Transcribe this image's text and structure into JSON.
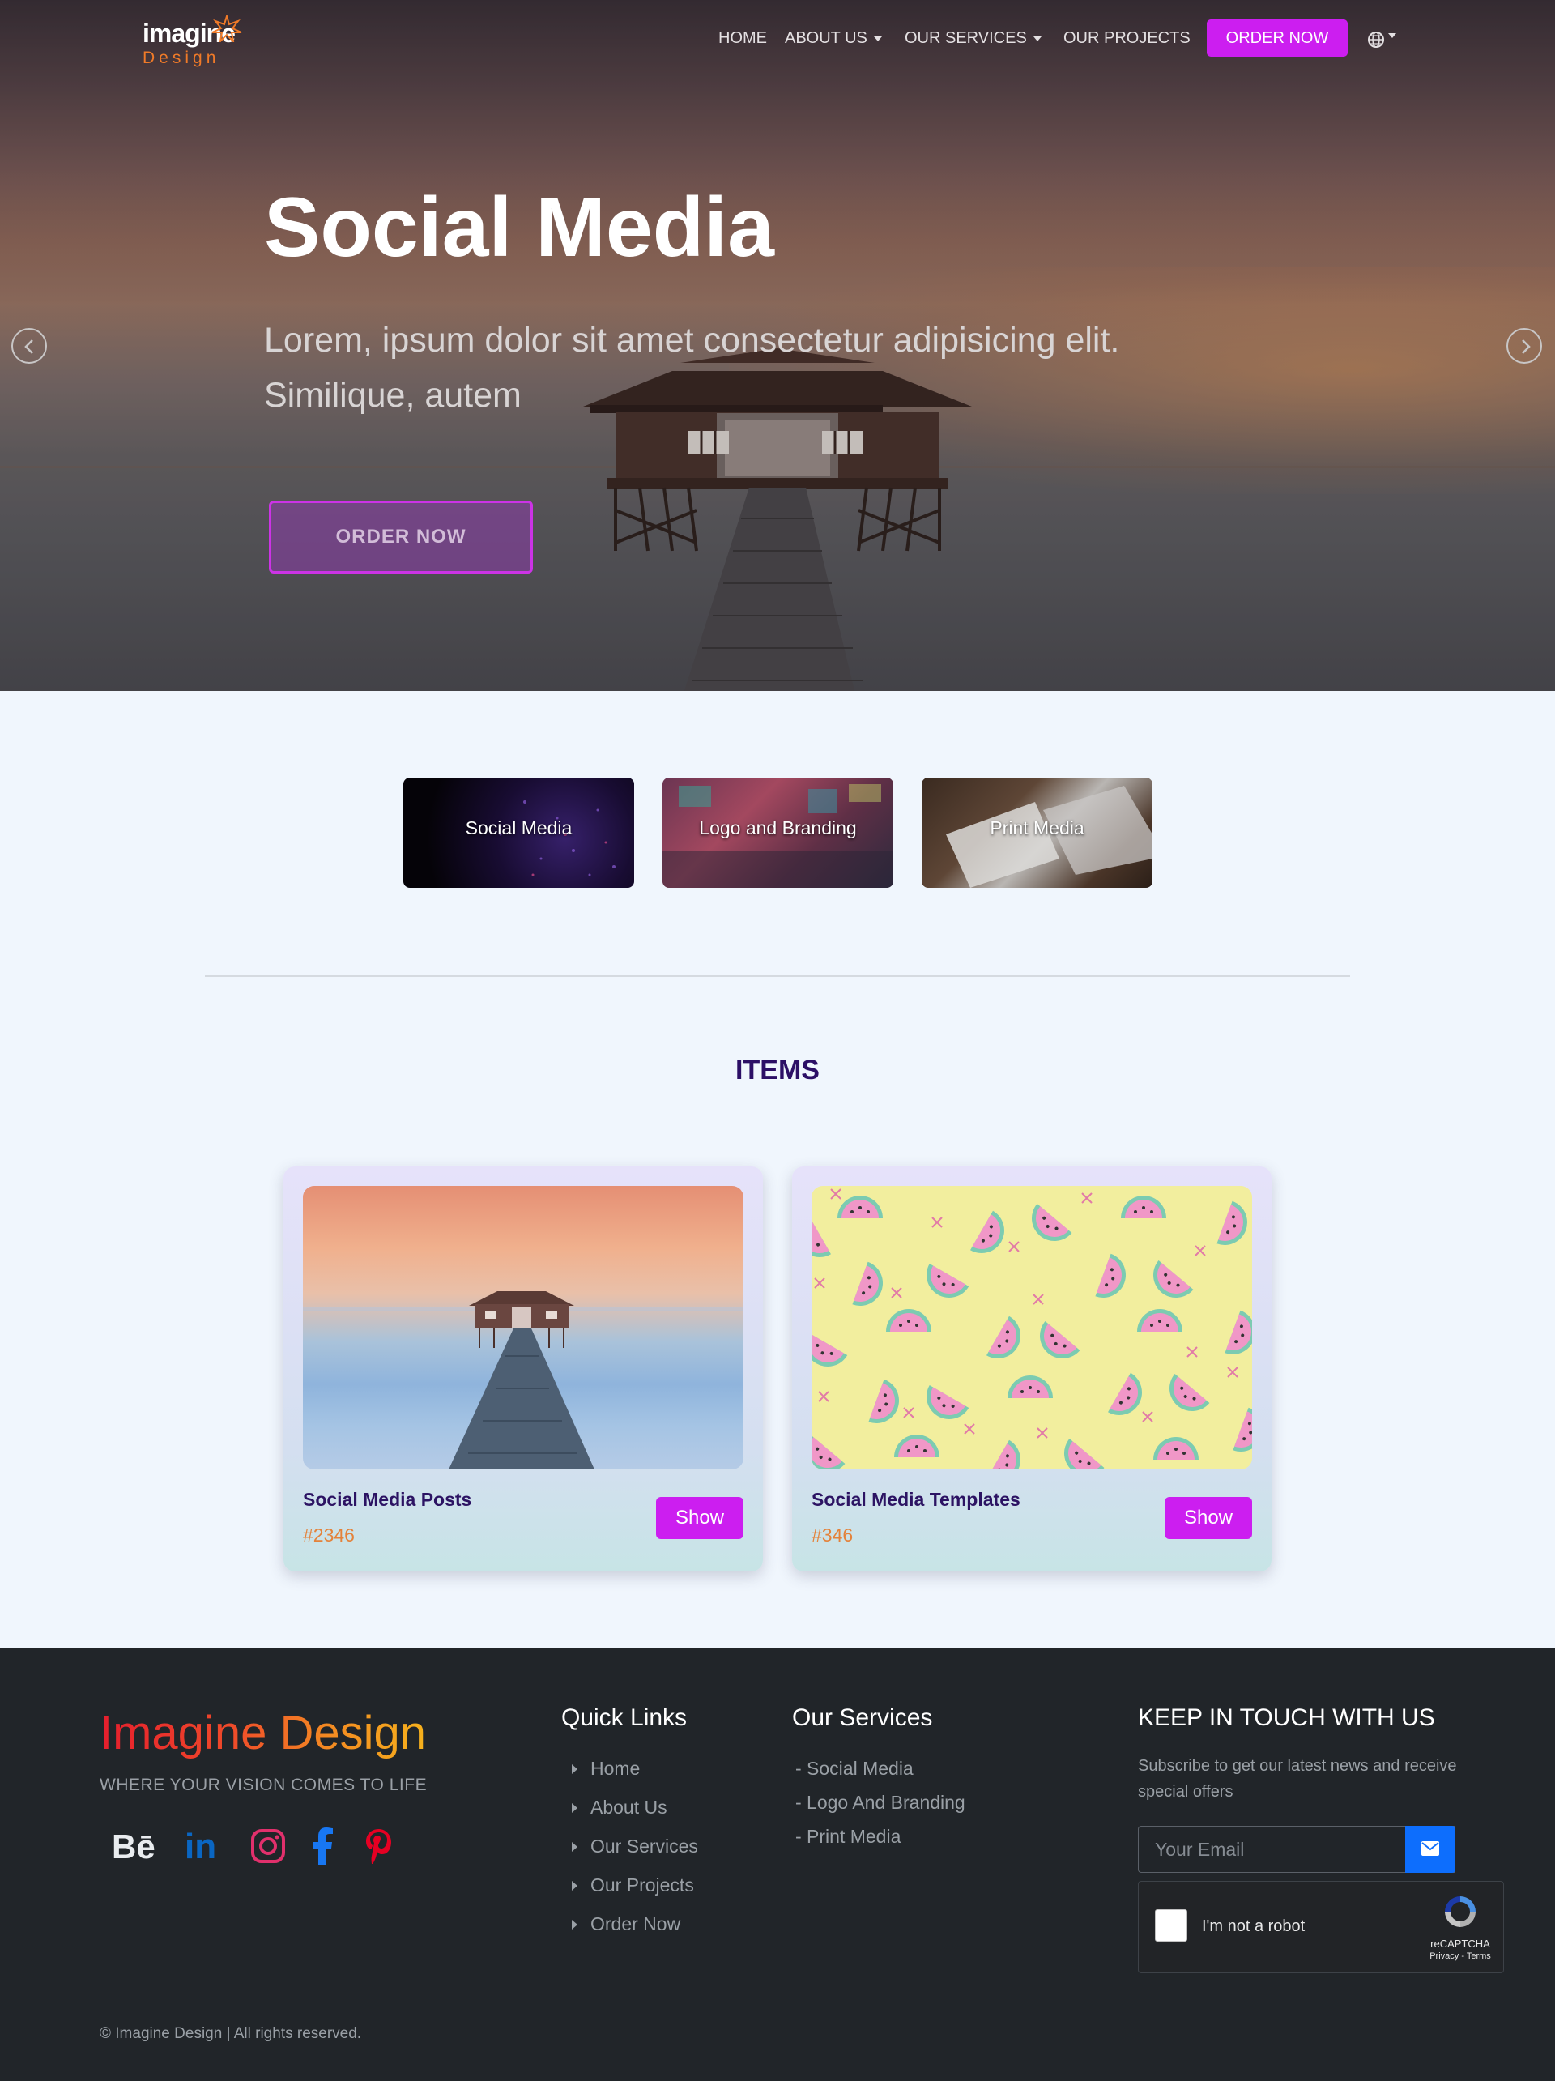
{
  "brand": {
    "logo_top": "imagine",
    "logo_bottom": "Design"
  },
  "nav": {
    "items": [
      {
        "label": "HOME",
        "dropdown": false
      },
      {
        "label": "ABOUT US",
        "dropdown": true
      },
      {
        "label": "OUR SERVICES",
        "dropdown": true
      },
      {
        "label": "OUR PROJECTS",
        "dropdown": false
      }
    ],
    "order_label": "ORDER NOW",
    "language_icon": "globe-icon"
  },
  "hero": {
    "title": "Social Media",
    "subtitle": "Lorem, ipsum dolor sit amet consectetur adipisicing elit. Similique, autem",
    "button_label": "ORDER NOW",
    "prev_icon": "chevron-left-icon",
    "next_icon": "chevron-right-icon"
  },
  "categories": [
    {
      "label": "Social Media"
    },
    {
      "label": "Logo and Branding"
    },
    {
      "label": "Print Media"
    }
  ],
  "items_section": {
    "title": "ITEMS",
    "cards": [
      {
        "title": "Social Media Posts",
        "code": "#2346",
        "button": "Show"
      },
      {
        "title": "Social Media Templates",
        "code": "#346",
        "button": "Show"
      }
    ]
  },
  "footer": {
    "brand": "Imagine Design",
    "tagline": "WHERE YOUR VISION COMES TO LIFE",
    "socials": [
      "behance-icon",
      "linkedin-icon",
      "instagram-icon",
      "facebook-icon",
      "pinterest-icon"
    ],
    "quick_links_title": "Quick Links",
    "quick_links": [
      "Home",
      "About Us",
      "Our Services",
      "Our Projects",
      "Order Now"
    ],
    "services_title": "Our Services",
    "services": [
      "- Social Media",
      "- Logo And Branding",
      "- Print Media"
    ],
    "newsletter_title": "KEEP IN TOUCH WITH US",
    "newsletter_text": "Subscribe to get our latest news and receive special offers",
    "email_placeholder": "Your Email",
    "captcha_label": "I'm not a robot",
    "captcha_brand": "reCAPTCHA",
    "captcha_terms": "Privacy - Terms",
    "copyright": "© Imagine Design | All rights reserved."
  },
  "colors": {
    "accent": "#cc1ef0",
    "heading": "#2c0f66",
    "code": "#e4823a",
    "footer_bg": "#212529",
    "subscribe": "#0d6efd"
  }
}
